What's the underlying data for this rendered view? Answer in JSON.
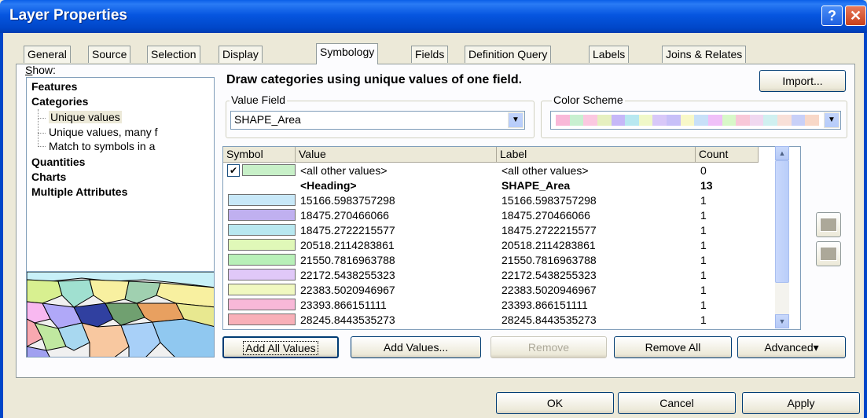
{
  "window": {
    "title": "Layer Properties",
    "help_label": "?",
    "close_label": "✕"
  },
  "tabs": [
    "General",
    "Source",
    "Selection",
    "Display",
    "Symbology",
    "Fields",
    "Definition Query",
    "Labels",
    "Joins & Relates"
  ],
  "active_tab": "Symbology",
  "show": {
    "label": "Show:",
    "items": {
      "features": "Features",
      "categories": "Categories",
      "unique_values": "Unique values",
      "unique_values_many": "Unique values, many f",
      "match_symbols": "Match to symbols in a",
      "quantities": "Quantities",
      "charts": "Charts",
      "multiple_attributes": "Multiple Attributes"
    }
  },
  "description": "Draw categories using unique values of one field.",
  "import_label": "Import...",
  "value_field": {
    "label": "Value Field",
    "value": "SHAPE_Area",
    "arrow": "▼"
  },
  "color_scheme": {
    "label": "Color Scheme",
    "arrow": "▼",
    "colors": [
      "#f9b8d8",
      "#c8f0d0",
      "#fbc8e0",
      "#e6f0c0",
      "#c6b8f8",
      "#b8e8f0",
      "#f0f8c8",
      "#d8c8f8",
      "#c8c0f8",
      "#f8f8c8",
      "#c8e0f8",
      "#f0c0f8",
      "#d8f8c8",
      "#f8c8d8",
      "#f0d8f0",
      "#d0f0f0",
      "#f8e0d8",
      "#c8d0f8",
      "#f8d8c8"
    ]
  },
  "grid": {
    "headers": {
      "symbol": "Symbol",
      "value": "Value",
      "label": "Label",
      "count": "Count"
    },
    "rows": [
      {
        "check": "✔",
        "color": "#c8f0c8",
        "value": "<all other values>",
        "label": "<all other values>",
        "count": "0",
        "bold": false
      },
      {
        "check": "",
        "color": "",
        "value": "<Heading>",
        "label": "SHAPE_Area",
        "count": "13",
        "bold": true
      },
      {
        "check": "",
        "color": "#c8e8f8",
        "value": "15166.5983757298",
        "label": "15166.5983757298",
        "count": "1",
        "bold": false
      },
      {
        "check": "",
        "color": "#c0b0f0",
        "value": "18475.270466066",
        "label": "18475.270466066",
        "count": "1",
        "bold": false
      },
      {
        "check": "",
        "color": "#b8e8f0",
        "value": "18475.2722215577",
        "label": "18475.2722215577",
        "count": "1",
        "bold": false
      },
      {
        "check": "",
        "color": "#e0f8b8",
        "value": "20518.2114283861",
        "label": "20518.2114283861",
        "count": "1",
        "bold": false
      },
      {
        "check": "",
        "color": "#b8f0b8",
        "value": "21550.7816963788",
        "label": "21550.7816963788",
        "count": "1",
        "bold": false
      },
      {
        "check": "",
        "color": "#e0c8f8",
        "value": "22172.5438255323",
        "label": "22172.5438255323",
        "count": "1",
        "bold": false
      },
      {
        "check": "",
        "color": "#f0f8c0",
        "value": "22383.5020946967",
        "label": "22383.5020946967",
        "count": "1",
        "bold": false
      },
      {
        "check": "",
        "color": "#f8b8d8",
        "value": "23393.866151111",
        "label": "23393.866151111",
        "count": "1",
        "bold": false
      },
      {
        "check": "",
        "color": "#f8b0b8",
        "value": "28245.8443535273",
        "label": "28245.8443535273",
        "count": "1",
        "bold": false
      }
    ],
    "scroll_up": "▲",
    "scroll_down": "▼"
  },
  "buttons": {
    "add_all_values": "Add All Values",
    "add_values": "Add Values...",
    "remove": "Remove",
    "remove_all": "Remove All",
    "advanced": "Advanced",
    "advanced_arrow": "▾",
    "ok": "OK",
    "cancel": "Cancel",
    "apply": "Apply"
  }
}
